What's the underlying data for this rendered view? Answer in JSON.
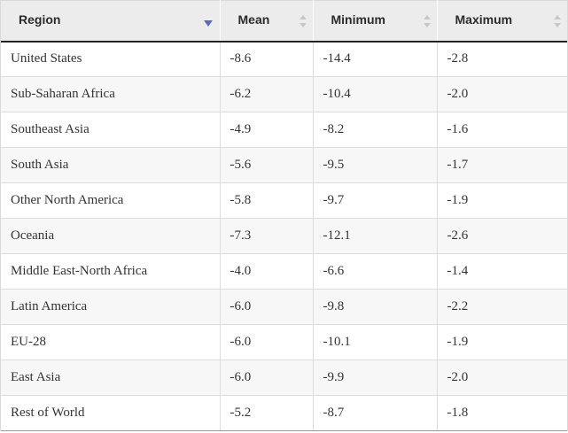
{
  "table": {
    "columns": [
      {
        "label": "Region",
        "sorted": "desc"
      },
      {
        "label": "Mean",
        "sorted": "none"
      },
      {
        "label": "Minimum",
        "sorted": "none"
      },
      {
        "label": "Maximum",
        "sorted": "none"
      }
    ],
    "rows": [
      {
        "region": "United States",
        "mean": "-8.6",
        "min": "-14.4",
        "max": "-2.8"
      },
      {
        "region": "Sub-Saharan Africa",
        "mean": "-6.2",
        "min": "-10.4",
        "max": "-2.0"
      },
      {
        "region": "Southeast Asia",
        "mean": "-4.9",
        "min": "-8.2",
        "max": "-1.6"
      },
      {
        "region": "South Asia",
        "mean": "-5.6",
        "min": "-9.5",
        "max": "-1.7"
      },
      {
        "region": "Other North America",
        "mean": "-5.8",
        "min": "-9.7",
        "max": "-1.9"
      },
      {
        "region": "Oceania",
        "mean": "-7.3",
        "min": "-12.1",
        "max": "-2.6"
      },
      {
        "region": "Middle East-North Africa",
        "mean": "-4.0",
        "min": "-6.6",
        "max": "-1.4"
      },
      {
        "region": "Latin America",
        "mean": "-6.0",
        "min": "-9.8",
        "max": "-2.2"
      },
      {
        "region": "EU-28",
        "mean": "-6.0",
        "min": "-10.1",
        "max": "-1.9"
      },
      {
        "region": "East Asia",
        "mean": "-6.0",
        "min": "-9.9",
        "max": "-2.0"
      },
      {
        "region": "Rest of World",
        "mean": "-5.2",
        "min": "-8.7",
        "max": "-1.8"
      }
    ]
  },
  "colors": {
    "header_bg": "#ececec",
    "header_rule": "#222222",
    "active_sort": "#5b6bc0",
    "inactive_sort": "#c8c8c8",
    "row_alt": "#f7f7f7"
  },
  "icons": {
    "active_sort": "caret-down-icon",
    "inactive_sort": "sort-updown-icon"
  }
}
